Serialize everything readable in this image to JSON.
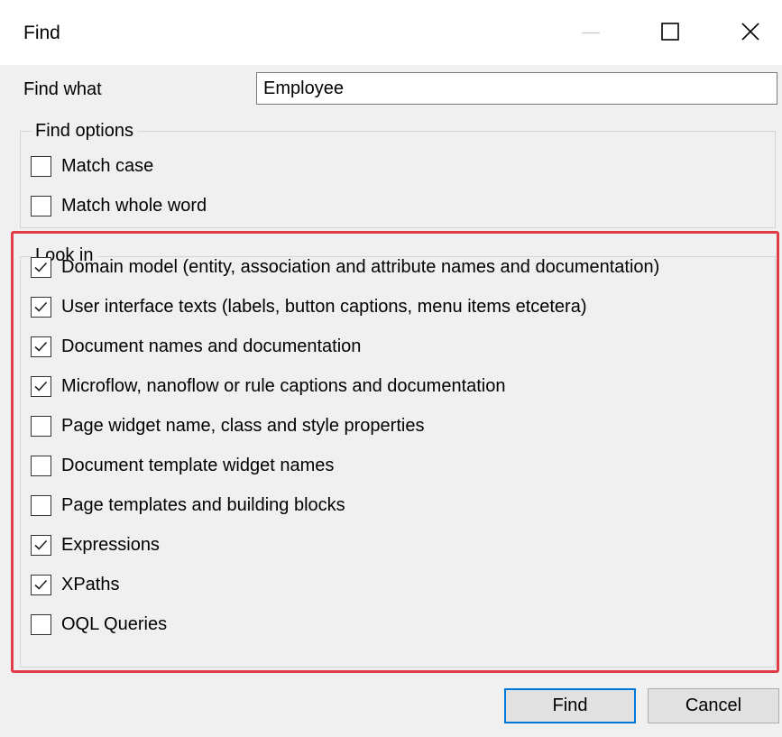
{
  "window": {
    "title": "Find",
    "controls": [
      "minimize-icon",
      "maximize-icon",
      "close-icon"
    ]
  },
  "find_what": {
    "label": "Find what",
    "value": "Employee"
  },
  "find_options": {
    "legend": "Find options",
    "items": [
      {
        "label": "Match case",
        "checked": false
      },
      {
        "label": "Match whole word",
        "checked": false
      }
    ]
  },
  "look_in": {
    "legend": "Look in",
    "highlight_color": "#e03c46",
    "items": [
      {
        "label": "Domain model (entity, association and attribute names and documentation)",
        "checked": true
      },
      {
        "label": "User interface texts (labels, button captions, menu items etcetera)",
        "checked": true
      },
      {
        "label": "Document names and documentation",
        "checked": true
      },
      {
        "label": "Microflow, nanoflow or rule captions and documentation",
        "checked": true
      },
      {
        "label": "Page widget name, class and style properties",
        "checked": false
      },
      {
        "label": "Document template widget names",
        "checked": false
      },
      {
        "label": "Page templates and building blocks",
        "checked": false
      },
      {
        "label": "Expressions",
        "checked": true
      },
      {
        "label": "XPaths",
        "checked": true
      },
      {
        "label": "OQL Queries",
        "checked": false
      }
    ]
  },
  "buttons": {
    "find_label": "Find",
    "cancel_label": "Cancel",
    "default_border_color": "#0078d7"
  }
}
